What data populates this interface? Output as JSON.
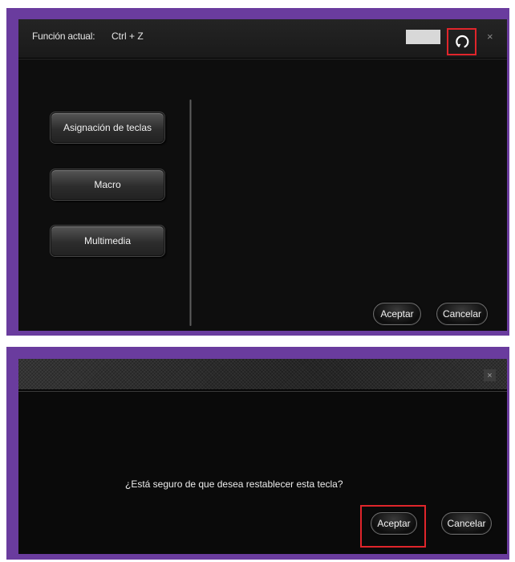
{
  "top_dialog": {
    "current_function_label": "Función actual:",
    "current_function_value": "Ctrl + Z",
    "close_glyph": "×",
    "reset_icon": "reset-icon",
    "side_buttons": [
      {
        "label": "Asignación de teclas"
      },
      {
        "label": "Macro"
      },
      {
        "label": "Multimedia"
      }
    ],
    "accept_label": "Aceptar",
    "cancel_label": "Cancelar"
  },
  "bottom_dialog": {
    "close_glyph": "×",
    "message": "¿Está seguro de que desea restablecer esta tecla?",
    "accept_label": "Aceptar",
    "cancel_label": "Cancelar"
  },
  "colors": {
    "frame": "#6a3c9e",
    "highlight": "#e0252b",
    "dialog_bg": "#0e0e0e"
  }
}
